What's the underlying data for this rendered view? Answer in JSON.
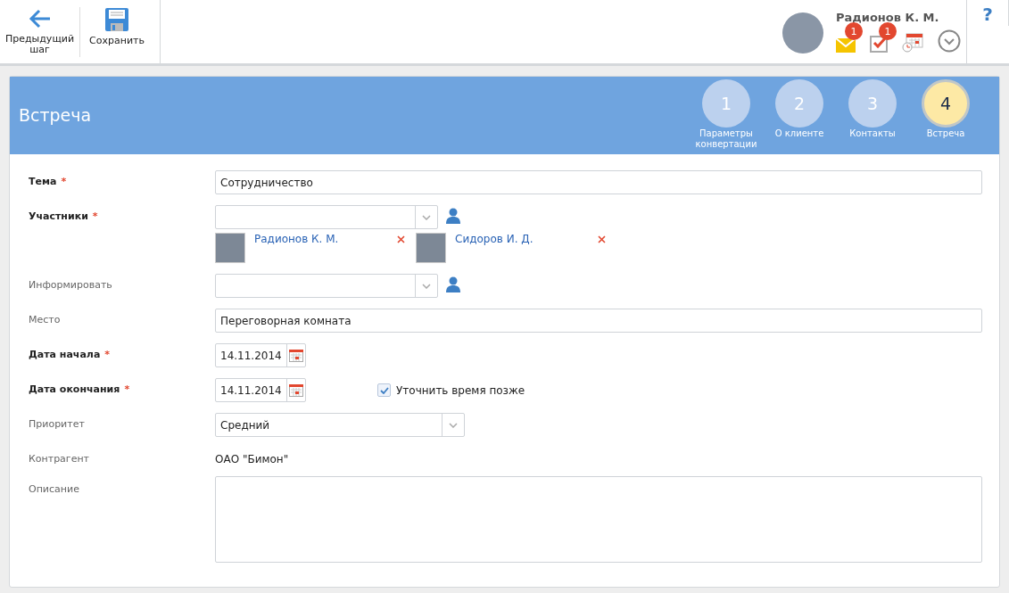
{
  "toolbar": {
    "buttons": [
      {
        "kind": "back",
        "label": "Предыдущий шаг"
      },
      {
        "kind": "save",
        "label": "Сохранить"
      }
    ]
  },
  "user": {
    "name": "Радионов К. М.",
    "notifications": [
      {
        "kind": "mail",
        "badge": "1"
      },
      {
        "kind": "tasks",
        "badge": "1"
      },
      {
        "kind": "calendar"
      },
      {
        "kind": "more"
      }
    ]
  },
  "help": "?",
  "page": {
    "title": "Встреча",
    "steps": [
      {
        "number": "1",
        "label": "Параметры конвертации",
        "selected": false
      },
      {
        "number": "2",
        "label": "О клиенте",
        "selected": false
      },
      {
        "number": "3",
        "label": "Контакты",
        "selected": false
      },
      {
        "number": "4",
        "label": "Встреча",
        "selected": true
      }
    ]
  },
  "fields": [
    {
      "kind": "text",
      "label": "Тема",
      "required_mark": "*",
      "value": "Сотрудничество"
    },
    {
      "kind": "lookup",
      "label": "Участники",
      "required_mark": "*",
      "people": [
        {
          "name": "Радионов К. М."
        },
        {
          "name": "Сидоров И. Д."
        }
      ]
    },
    {
      "kind": "lookup",
      "label": "Информировать"
    },
    {
      "kind": "text",
      "label": "Место",
      "value": "Переговорная комната"
    },
    {
      "kind": "date",
      "label": "Дата начала",
      "required_mark": "*",
      "value": "14.11.2014"
    },
    {
      "kind": "date",
      "label": "Дата окончания",
      "required_mark": "*",
      "value": "14.11.2014",
      "option": {
        "label": "Уточнить время позже",
        "checked": true
      }
    },
    {
      "kind": "select",
      "label": "Приоритет",
      "value": "Средний"
    },
    {
      "kind": "static",
      "label": "Контрагент",
      "value": "ОАО \"Бимон\""
    },
    {
      "kind": "textarea",
      "label": "Описание"
    }
  ]
}
